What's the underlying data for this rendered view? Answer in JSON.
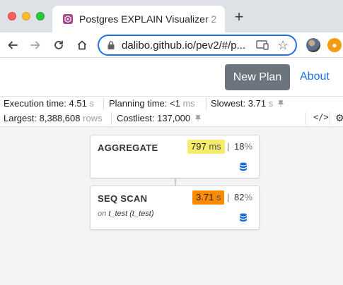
{
  "browser": {
    "tab_title": "Postgres EXPLAIN Visualizer 2",
    "url": "dalibo.github.io/pev2/#/p...",
    "new_tab_symbol": "+"
  },
  "header": {
    "new_plan_label": "New Plan",
    "about_label": "About"
  },
  "stats": {
    "execution_label": "Execution time:",
    "execution_value": "4.51",
    "execution_unit": "s",
    "planning_label": "Planning time:",
    "planning_value": "<1",
    "planning_unit": "ms",
    "slowest_label": "Slowest:",
    "slowest_value": "3.71",
    "slowest_unit": "s",
    "largest_label": "Largest:",
    "largest_value": "8,388,608",
    "largest_unit": "rows",
    "costliest_label": "Costliest:",
    "costliest_value": "137,000"
  },
  "nodes": [
    {
      "title": "AGGREGATE",
      "time_value": "797",
      "time_unit": "ms",
      "pipe": "|",
      "pct_value": "18",
      "pct_unit": "%",
      "badge_color": "#f5ec6b"
    },
    {
      "title": "SEQ SCAN",
      "time_value": "3.71",
      "time_unit": "s",
      "pipe": "|",
      "pct_value": "82",
      "pct_unit": "%",
      "badge_color": "#fb8a00",
      "on_keyword": "on",
      "relation": "t_test (t_test)"
    }
  ],
  "colors": {
    "accent": "#1a73e8",
    "button_gray": "#6c757d",
    "db_icon": "#1a6fd4"
  },
  "icons": {
    "back": "arrow-left-icon",
    "forward": "arrow-right-icon",
    "reload": "reload-icon",
    "home": "home-icon",
    "lock": "lock-icon",
    "cast": "cast-icon",
    "bookmark": "star-icon",
    "code": "code-icon",
    "settings": "gear-icon",
    "database": "database-icon"
  }
}
